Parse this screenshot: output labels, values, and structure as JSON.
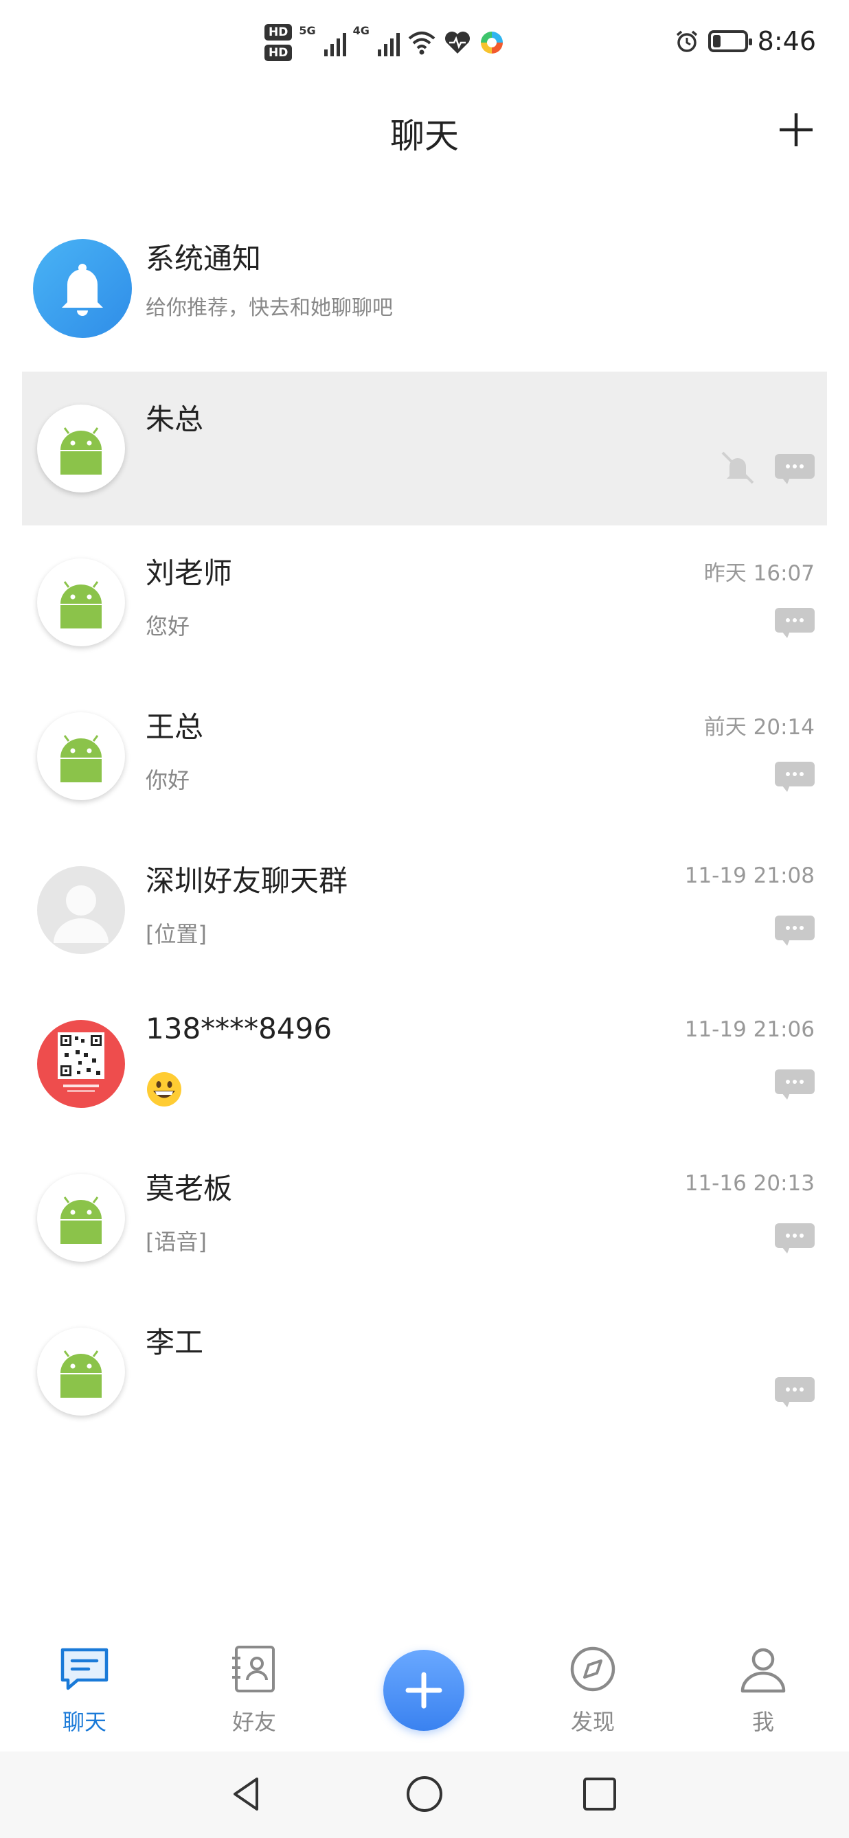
{
  "status_bar": {
    "hd1": "HD",
    "hd2": "HD",
    "net1": "5G",
    "net2": "4G",
    "time": "8:46",
    "battery_level": 0.25
  },
  "header": {
    "title": "聊天",
    "add_icon": "plus-icon"
  },
  "chats": [
    {
      "name": "系统通知",
      "preview": "给你推荐，快去和她聊聊吧",
      "time": "",
      "avatar": "bell"
    },
    {
      "name": "朱总",
      "preview": "",
      "time": "",
      "avatar": "android",
      "muted": true
    },
    {
      "name": "刘老师",
      "preview": "您好",
      "time": "昨天 16:07",
      "avatar": "android"
    },
    {
      "name": "王总",
      "preview": "你好",
      "time": "前天 20:14",
      "avatar": "android"
    },
    {
      "name": "深圳好友聊天群",
      "preview": "[位置]",
      "time": "11-19 21:08",
      "avatar": "default-user"
    },
    {
      "name": "138****8496",
      "preview": "",
      "time": "11-19 21:06",
      "avatar": "qr-code",
      "emoji": "grinning-face"
    },
    {
      "name": "莫老板",
      "preview": "[语音]",
      "time": "11-16 20:13",
      "avatar": "android"
    },
    {
      "name": "李工",
      "preview": "",
      "time": "",
      "avatar": "android"
    }
  ],
  "bottom_nav": {
    "tabs": [
      {
        "label": "聊天",
        "icon": "chat-icon",
        "active": true
      },
      {
        "label": "好友",
        "icon": "contacts-icon",
        "active": false
      },
      {
        "label": "发现",
        "icon": "compass-icon",
        "active": false
      },
      {
        "label": "我",
        "icon": "person-icon",
        "active": false
      }
    ],
    "center_icon": "plus-icon"
  },
  "colors": {
    "accent": "#1a7ad8",
    "active_row": "#eeeeee",
    "android_green": "#8bc34a"
  }
}
